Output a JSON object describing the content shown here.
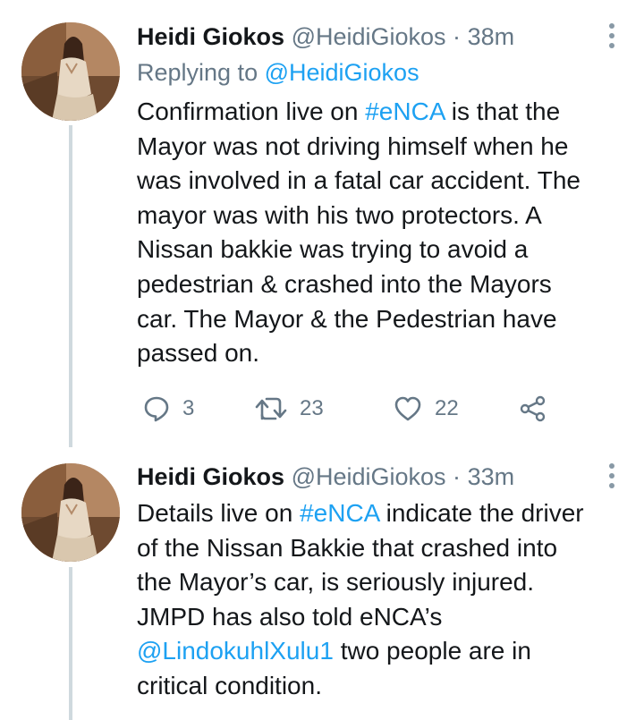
{
  "tweets": [
    {
      "name": "Heidi Giokos",
      "handle": "@HeidiGiokos",
      "separator": "·",
      "time": "38m",
      "reply_prefix": "Replying to",
      "reply_to": "@HeidiGiokos",
      "lines": [
        [
          {
            "t": "Confirmation live on "
          },
          {
            "t": "#eNCA",
            "link": true
          },
          {
            "t": " is that the"
          }
        ],
        [
          {
            "t": "Mayor was not driving himself when he"
          }
        ],
        [
          {
            "t": "was involved in a fatal car accident. The"
          }
        ],
        [
          {
            "t": "mayor was with his two protectors. A"
          }
        ],
        [
          {
            "t": "Nissan bakkie was trying to avoid a"
          }
        ],
        [
          {
            "t": "pedestrian & crashed into the Mayors"
          }
        ],
        [
          {
            "t": "car. The Mayor & the Pedestrian have"
          }
        ],
        [
          {
            "t": "passed on."
          }
        ]
      ],
      "replies": "3",
      "retweets": "23",
      "likes": "22"
    },
    {
      "name": "Heidi Giokos",
      "handle": "@HeidiGiokos",
      "separator": "·",
      "time": "33m",
      "lines": [
        [
          {
            "t": "Details live on "
          },
          {
            "t": "#eNCA",
            "link": true
          },
          {
            "t": " indicate the driver"
          }
        ],
        [
          {
            "t": "of the Nissan Bakkie that crashed into"
          }
        ],
        [
          {
            "t": "the Mayor’s car, is seriously injured."
          }
        ],
        [
          {
            "t": "JMPD has also told eNCA’s"
          }
        ],
        [
          {
            "t": "@LindokuhlXulu1",
            "link": true
          },
          {
            "t": " two people are in"
          }
        ],
        [
          {
            "t": "critical condition."
          }
        ]
      ]
    }
  ],
  "colors": {
    "link": "#1da1f2",
    "muted": "#657786",
    "thread_line": "#cfd9de"
  },
  "icons": [
    "reply-icon",
    "retweet-icon",
    "like-icon",
    "share-icon",
    "more-options-icon",
    "avatar"
  ]
}
